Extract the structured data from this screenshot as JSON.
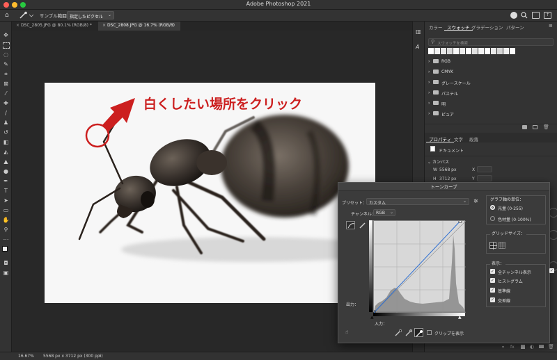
{
  "window": {
    "title": "Adobe Photoshop 2021"
  },
  "options_bar": {
    "sample_label": "サンプル範囲：",
    "sample_value": "指定したピクセル"
  },
  "tabs": [
    {
      "label": "DSC_2805.JPG @ 80.1% (RGB/8) *",
      "active": false
    },
    {
      "label": "DSC_2808.JPG @ 16.7% (RGB/8)",
      "active": true
    }
  ],
  "annotation": {
    "text": "白くしたい場所をクリック",
    "color": "#cc1f1f"
  },
  "swatches_panel": {
    "tabs": [
      "カラー",
      "スウォッチ",
      "グラデーション",
      "パターン"
    ],
    "active_tab": "スウォッチ",
    "search_placeholder": "スウォッチを検索",
    "folders": [
      "RGB",
      "CMYK",
      "グレースケール",
      "パステル",
      "明",
      "ピュア"
    ]
  },
  "properties_panel": {
    "tabs": [
      "プロパティ",
      "文字",
      "段落"
    ],
    "active_tab": "プロパティ",
    "doc_label": "ドキュメント",
    "section": "カンバス",
    "w_label": "W",
    "w_value": "5568 px",
    "h_label": "H",
    "h_value": "3712 px",
    "x_label": "X",
    "y_label": "Y"
  },
  "curves_dialog": {
    "title": "トーンカーブ",
    "preset_label": "プリセット：",
    "preset_value": "カスタム",
    "channel_label": "チャンネル：",
    "channel_value": "RGB",
    "output_label": "出力：",
    "input_label": "入力：",
    "show_clipping": "クリップを表示",
    "graph_unit_title": "グラフ軸の単位：",
    "unit_light": "光量 (0-255)",
    "unit_pigment": "色材量 (0-100%)",
    "grid_size_title": "グリッドサイズ：",
    "display_title": "表示：",
    "display_options": [
      "全チャンネル表示",
      "ヒストグラム",
      "基準線",
      "交差線"
    ]
  },
  "status_bar": {
    "zoom": "16.67%",
    "doc_info": "5568 px x 3712 px (300 ppi)"
  },
  "colors": {
    "accent_blue": "#2d6fd3",
    "annotation_red": "#cc1f1f"
  }
}
